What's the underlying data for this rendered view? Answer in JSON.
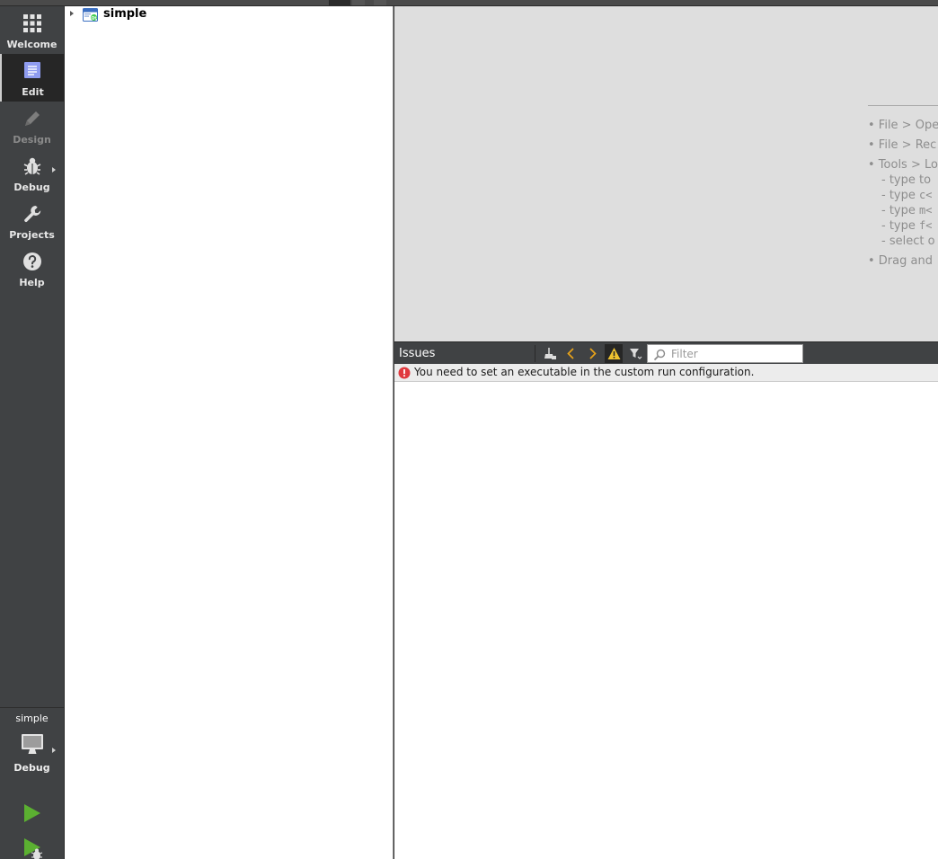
{
  "modes": [
    {
      "label": "Welcome",
      "icon": "grid-icon"
    },
    {
      "label": "Edit",
      "icon": "document-icon"
    },
    {
      "label": "Design",
      "icon": "pencil-icon"
    },
    {
      "label": "Debug",
      "icon": "bug-icon"
    },
    {
      "label": "Projects",
      "icon": "wrench-icon"
    },
    {
      "label": "Help",
      "icon": "help-icon"
    }
  ],
  "kit": {
    "project": "simple",
    "build": "Debug",
    "icon": "monitor-icon"
  },
  "actions": {
    "run": "run-icon",
    "debug_run": "debug-run-icon"
  },
  "tree": {
    "root": "simple"
  },
  "editor_hints": {
    "l1": "• File > Ope",
    "l2": "• File > Rec",
    "l3": "• Tools > Lo",
    "l4": "- type to",
    "l5a": "- type ",
    "l5b": "c<",
    "l6a": "- type ",
    "l6b": "m<",
    "l7a": "- type ",
    "l7b": "f<",
    "l8": "- select o",
    "l9": "• Drag and"
  },
  "issues": {
    "title": "Issues",
    "filter_placeholder": "Filter",
    "message": "You need to set an executable in the custom run configuration."
  },
  "colors": {
    "mode_bar": "#404244",
    "run_green": "#5bb031",
    "error_red": "#e0393e",
    "warning_yellow": "#f0c330",
    "nav_arrow": "#e7a21a"
  }
}
